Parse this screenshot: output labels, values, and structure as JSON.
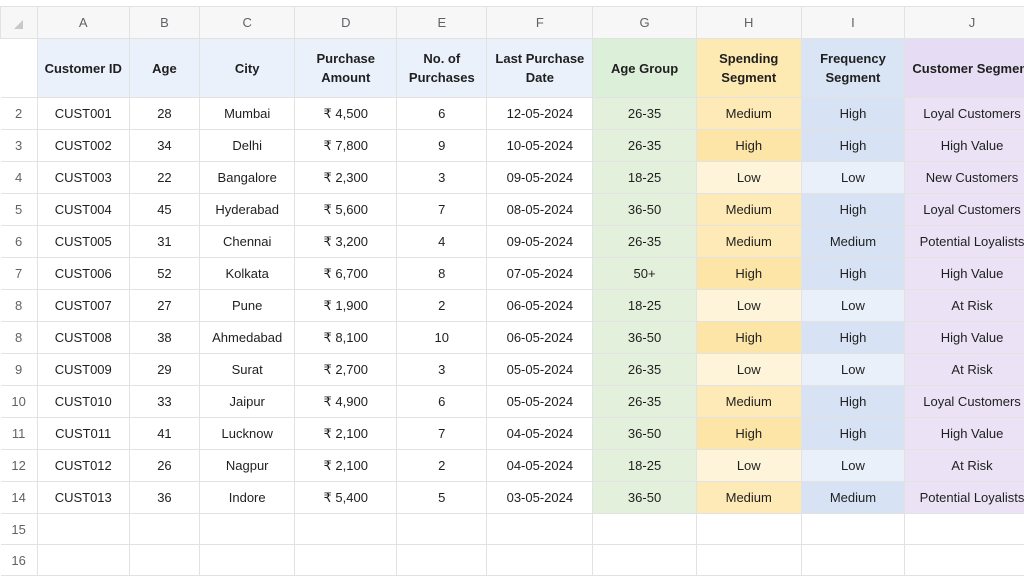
{
  "columns": [
    "A",
    "B",
    "C",
    "D",
    "E",
    "F",
    "G",
    "H",
    "I",
    "J"
  ],
  "header_row": {
    "row_number": "",
    "cells": [
      "Customer ID",
      "Age",
      "City",
      "Purchase Amount",
      "No. of Purchases",
      "Last Purchase Date",
      "Age Group",
      "Spending Segment",
      "Frequency Segment",
      "Customer Segment"
    ]
  },
  "rows": [
    {
      "row_number": "2",
      "cells": [
        "CUST001",
        "28",
        "Mumbai",
        "₹ 4,500",
        "6",
        "12-05-2024",
        "26-35",
        "Medium",
        "High",
        "Loyal Customers"
      ]
    },
    {
      "row_number": "3",
      "cells": [
        "CUST002",
        "34",
        "Delhi",
        "₹ 7,800",
        "9",
        "10-05-2024",
        "26-35",
        "High",
        "High",
        "High Value"
      ]
    },
    {
      "row_number": "4",
      "cells": [
        "CUST003",
        "22",
        "Bangalore",
        "₹ 2,300",
        "3",
        "09-05-2024",
        "18-25",
        "Low",
        "Low",
        "New Customers"
      ]
    },
    {
      "row_number": "5",
      "cells": [
        "CUST004",
        "45",
        "Hyderabad",
        "₹ 5,600",
        "7",
        "08-05-2024",
        "36-50",
        "Medium",
        "High",
        "Loyal Customers"
      ]
    },
    {
      "row_number": "6",
      "cells": [
        "CUST005",
        "31",
        "Chennai",
        "₹ 3,200",
        "4",
        "09-05-2024",
        "26-35",
        "Medium",
        "Medium",
        "Potential Loyalists"
      ]
    },
    {
      "row_number": "7",
      "cells": [
        "CUST006",
        "52",
        "Kolkata",
        "₹ 6,700",
        "8",
        "07-05-2024",
        "50+",
        "High",
        "High",
        "High Value"
      ]
    },
    {
      "row_number": "8",
      "cells": [
        "CUST007",
        "27",
        "Pune",
        "₹ 1,900",
        "2",
        "06-05-2024",
        "18-25",
        "Low",
        "Low",
        "At Risk"
      ]
    },
    {
      "row_number": "8",
      "cells": [
        "CUST008",
        "38",
        "Ahmedabad",
        "₹ 8,100",
        "10",
        "06-05-2024",
        "36-50",
        "High",
        "High",
        "High Value"
      ]
    },
    {
      "row_number": "9",
      "cells": [
        "CUST009",
        "29",
        "Surat",
        "₹ 2,700",
        "3",
        "05-05-2024",
        "26-35",
        "Low",
        "Low",
        "At Risk"
      ]
    },
    {
      "row_number": "10",
      "cells": [
        "CUST010",
        "33",
        "Jaipur",
        "₹ 4,900",
        "6",
        "05-05-2024",
        "26-35",
        "Medium",
        "High",
        "Loyal Customers"
      ]
    },
    {
      "row_number": "11",
      "cells": [
        "CUST011",
        "41",
        "Lucknow",
        "₹ 2,100",
        "7",
        "04-05-2024",
        "36-50",
        "High",
        "High",
        "High Value"
      ]
    },
    {
      "row_number": "12",
      "cells": [
        "CUST012",
        "26",
        "Nagpur",
        "₹ 2,100",
        "2",
        "04-05-2024",
        "18-25",
        "Low",
        "Low",
        "At Risk"
      ]
    },
    {
      "row_number": "14",
      "cells": [
        "CUST013",
        "36",
        "Indore",
        "₹ 5,400",
        "5",
        "03-05-2024",
        "36-50",
        "Medium",
        "Medium",
        "Potential Loyalists"
      ]
    }
  ],
  "empty_rows": [
    "15",
    "16"
  ],
  "colors": {
    "header_blue": "#eaf1fb",
    "age_group_green": "#dcefd9",
    "spending_amber": "#fde9b2",
    "frequency_blue": "#d9e5f5",
    "segment_purple": "#e6dcf3"
  }
}
